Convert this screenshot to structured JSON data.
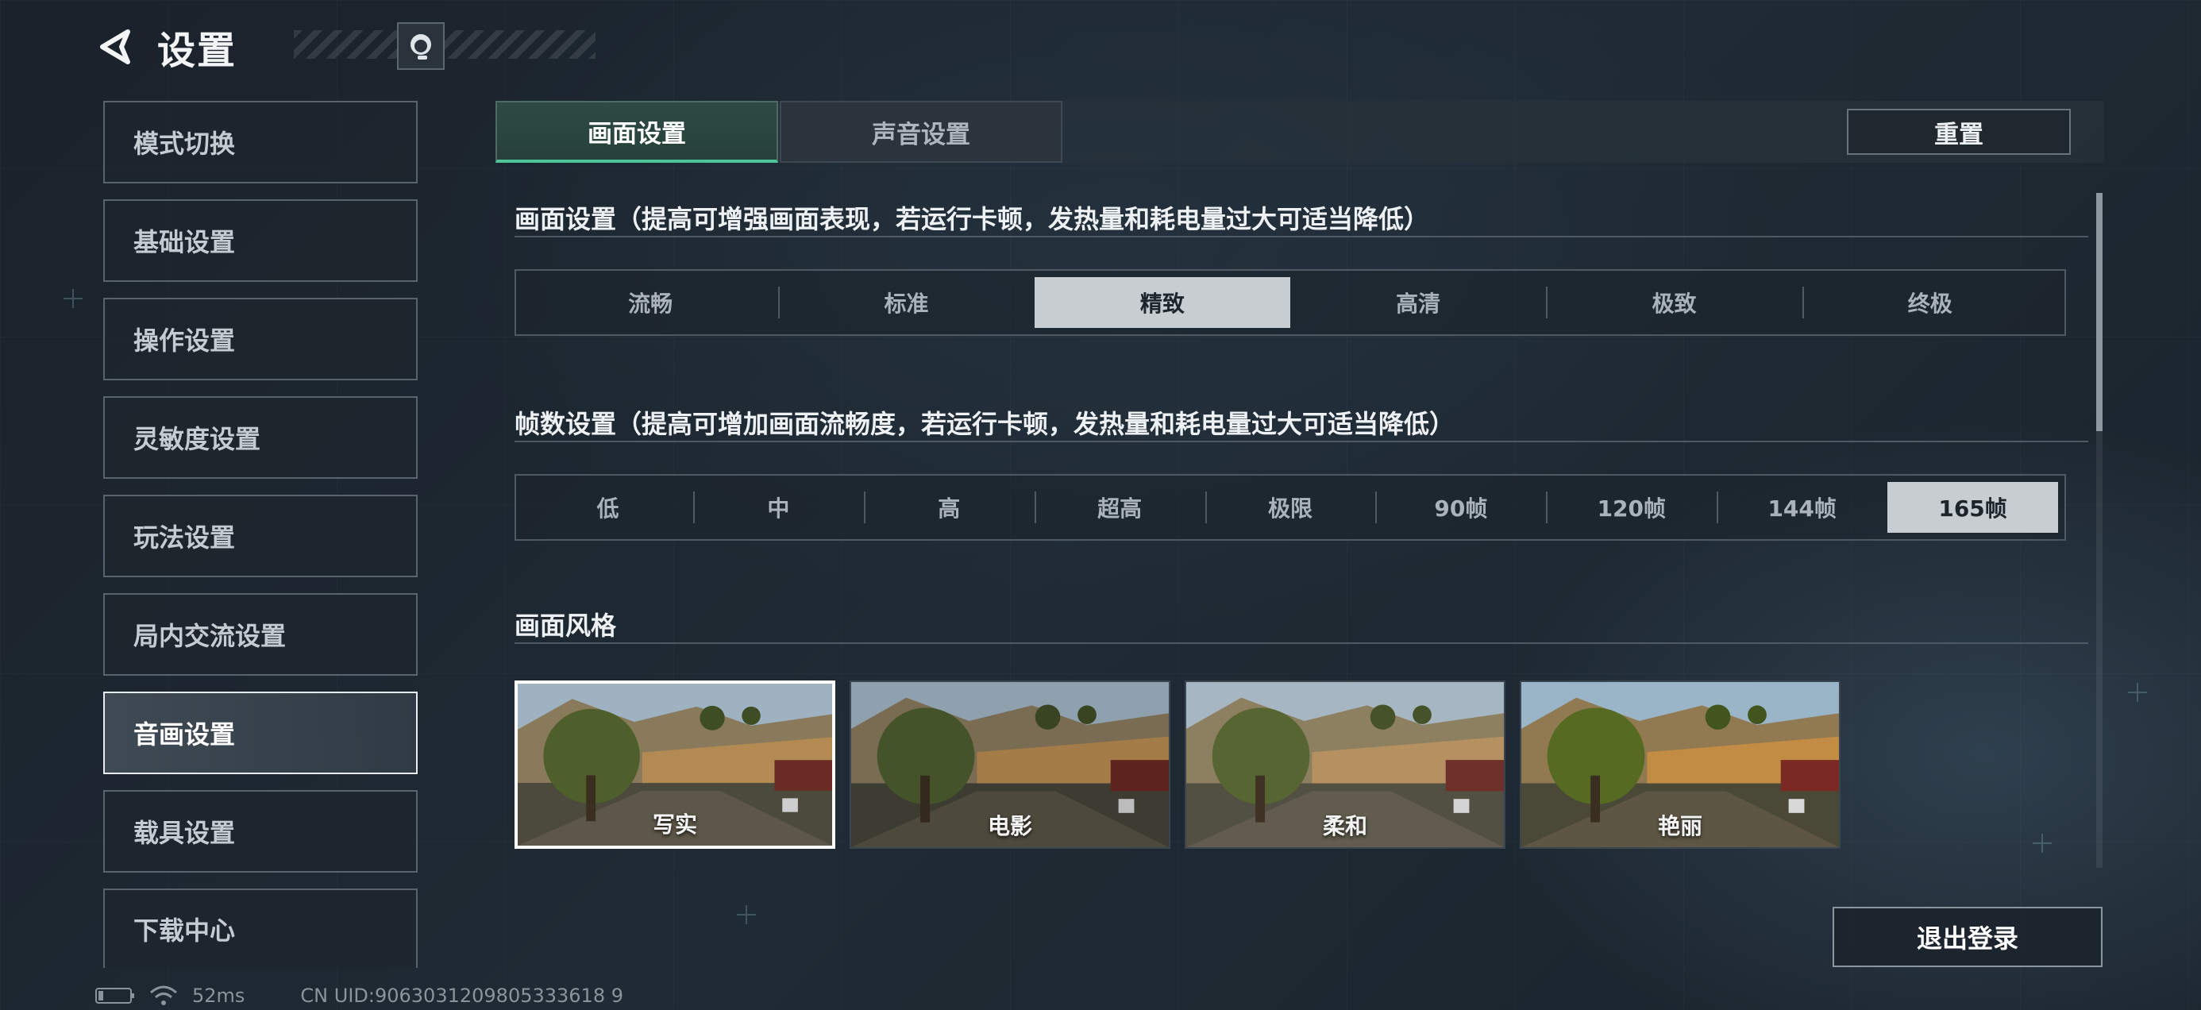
{
  "header": {
    "title": "设置"
  },
  "sidebar": {
    "items": [
      {
        "label": "模式切换",
        "active": false
      },
      {
        "label": "基础设置",
        "active": false
      },
      {
        "label": "操作设置",
        "active": false
      },
      {
        "label": "灵敏度设置",
        "active": false
      },
      {
        "label": "玩法设置",
        "active": false
      },
      {
        "label": "局内交流设置",
        "active": false
      },
      {
        "label": "音画设置",
        "active": true
      },
      {
        "label": "载具设置",
        "active": false
      },
      {
        "label": "下载中心",
        "active": false
      }
    ]
  },
  "tabs": [
    {
      "label": "画面设置",
      "active": true
    },
    {
      "label": "声音设置",
      "active": false
    }
  ],
  "reset_label": "重置",
  "graphics_quality": {
    "title": "画面设置（提高可增强画面表现，若运行卡顿，发热量和耗电量过大可适当降低）",
    "options": [
      "流畅",
      "标准",
      "精致",
      "高清",
      "极致",
      "终极"
    ],
    "selected": "精致"
  },
  "frame_rate": {
    "title": "帧数设置（提高可增加画面流畅度，若运行卡顿，发热量和耗电量过大可适当降低）",
    "options": [
      "低",
      "中",
      "高",
      "超高",
      "极限",
      "90帧",
      "120帧",
      "144帧",
      "165帧"
    ],
    "selected": "165帧"
  },
  "picture_style": {
    "title": "画面风格",
    "options": [
      {
        "label": "写实",
        "selected": true
      },
      {
        "label": "电影",
        "selected": false
      },
      {
        "label": "柔和",
        "selected": false
      },
      {
        "label": "艳丽",
        "selected": false
      }
    ]
  },
  "logout_label": "退出登录",
  "status": {
    "ping": "52ms",
    "uid": "CN UID:9063031209805333618 9"
  },
  "colors": {
    "accent": "#4fc39a",
    "selected_bg": "#c8cdd1",
    "background": "#1c252e"
  },
  "icons": [
    "back-arrow-icon",
    "customer-support-icon",
    "battery-icon",
    "wifi-icon"
  ]
}
